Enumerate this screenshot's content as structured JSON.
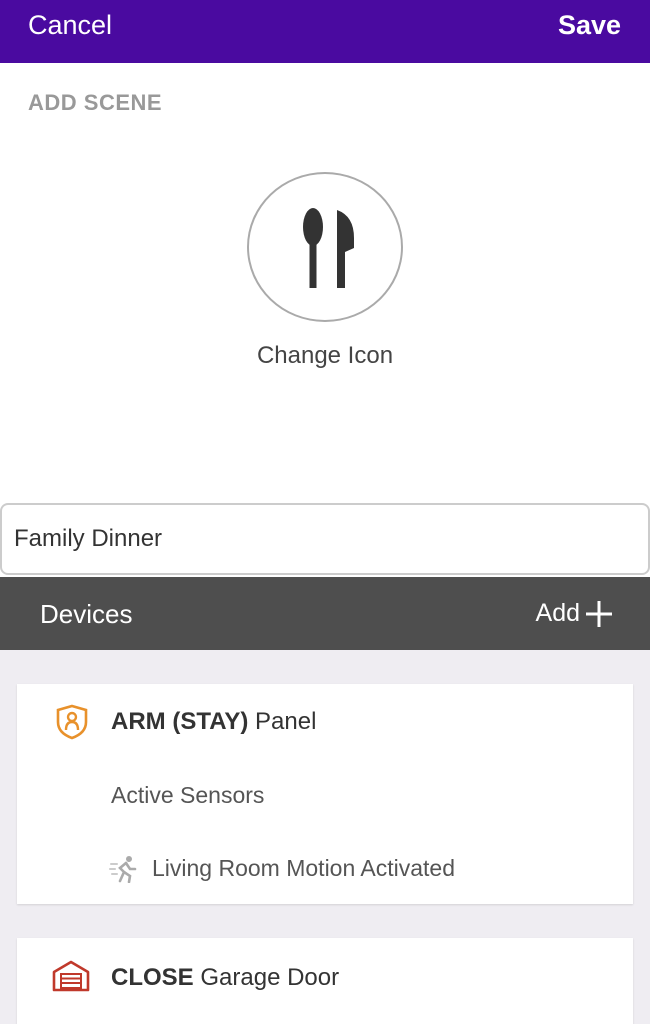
{
  "topbar": {
    "cancel_label": "Cancel",
    "save_label": "Save",
    "bg_color": "#4a0aa0"
  },
  "section_title": "ADD SCENE",
  "scene_icon": {
    "name": "dining-utensils-icon",
    "change_label": "Change Icon"
  },
  "scene_name": {
    "value": "Family Dinner"
  },
  "devices": {
    "title": "Devices",
    "add_label": "Add"
  },
  "device_cards": [
    {
      "icon": "shield-person-icon",
      "action": "ARM (STAY)",
      "device": "Panel",
      "sub_title": "Active Sensors",
      "sensor": {
        "icon": "running-motion-icon",
        "name": "Living Room Motion",
        "state": "Activated"
      }
    },
    {
      "icon": "garage-icon",
      "action": "CLOSE",
      "device": "Garage Door"
    }
  ]
}
